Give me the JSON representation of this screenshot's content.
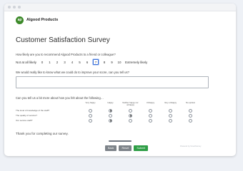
{
  "brand": {
    "name": "Algood Products",
    "logo_text": "ap",
    "color": "#3d8a2a"
  },
  "survey": {
    "title": "Customer Satisfaction Survey",
    "q1": "How likely are you to recommend Algood Products to a friend or colleague?",
    "nps": {
      "low_label": "Not at all likely",
      "high_label": "Extremely likely",
      "scale": [
        "0",
        "1",
        "2",
        "3",
        "4",
        "5",
        "6",
        "7",
        "8",
        "9",
        "10"
      ],
      "selected": "7"
    },
    "q2": "We would really like to know what we could do to improve your score, can you tell us?",
    "q2_value": "",
    "q3": "Can you tell us a bit more about how you felt about the following…",
    "matrix": {
      "columns": [
        "Very happy",
        "Happy",
        "Neither happy nor unhappy",
        "Unhappy",
        "Very unhappy",
        "No opinion"
      ],
      "rows": [
        {
          "label": "The level of knowledge of the staff?",
          "selected": 1
        },
        {
          "label": "The quality of service?",
          "selected": 2
        },
        {
          "label": "Our service staff?",
          "selected": 1
        }
      ]
    },
    "thanks": "Thank you for completing our survey.",
    "progress_percent": 100,
    "buttons": {
      "back": "Back",
      "reset": "Reset",
      "submit": "Submit"
    },
    "powered_by": "Powered by SmartSurvey"
  }
}
